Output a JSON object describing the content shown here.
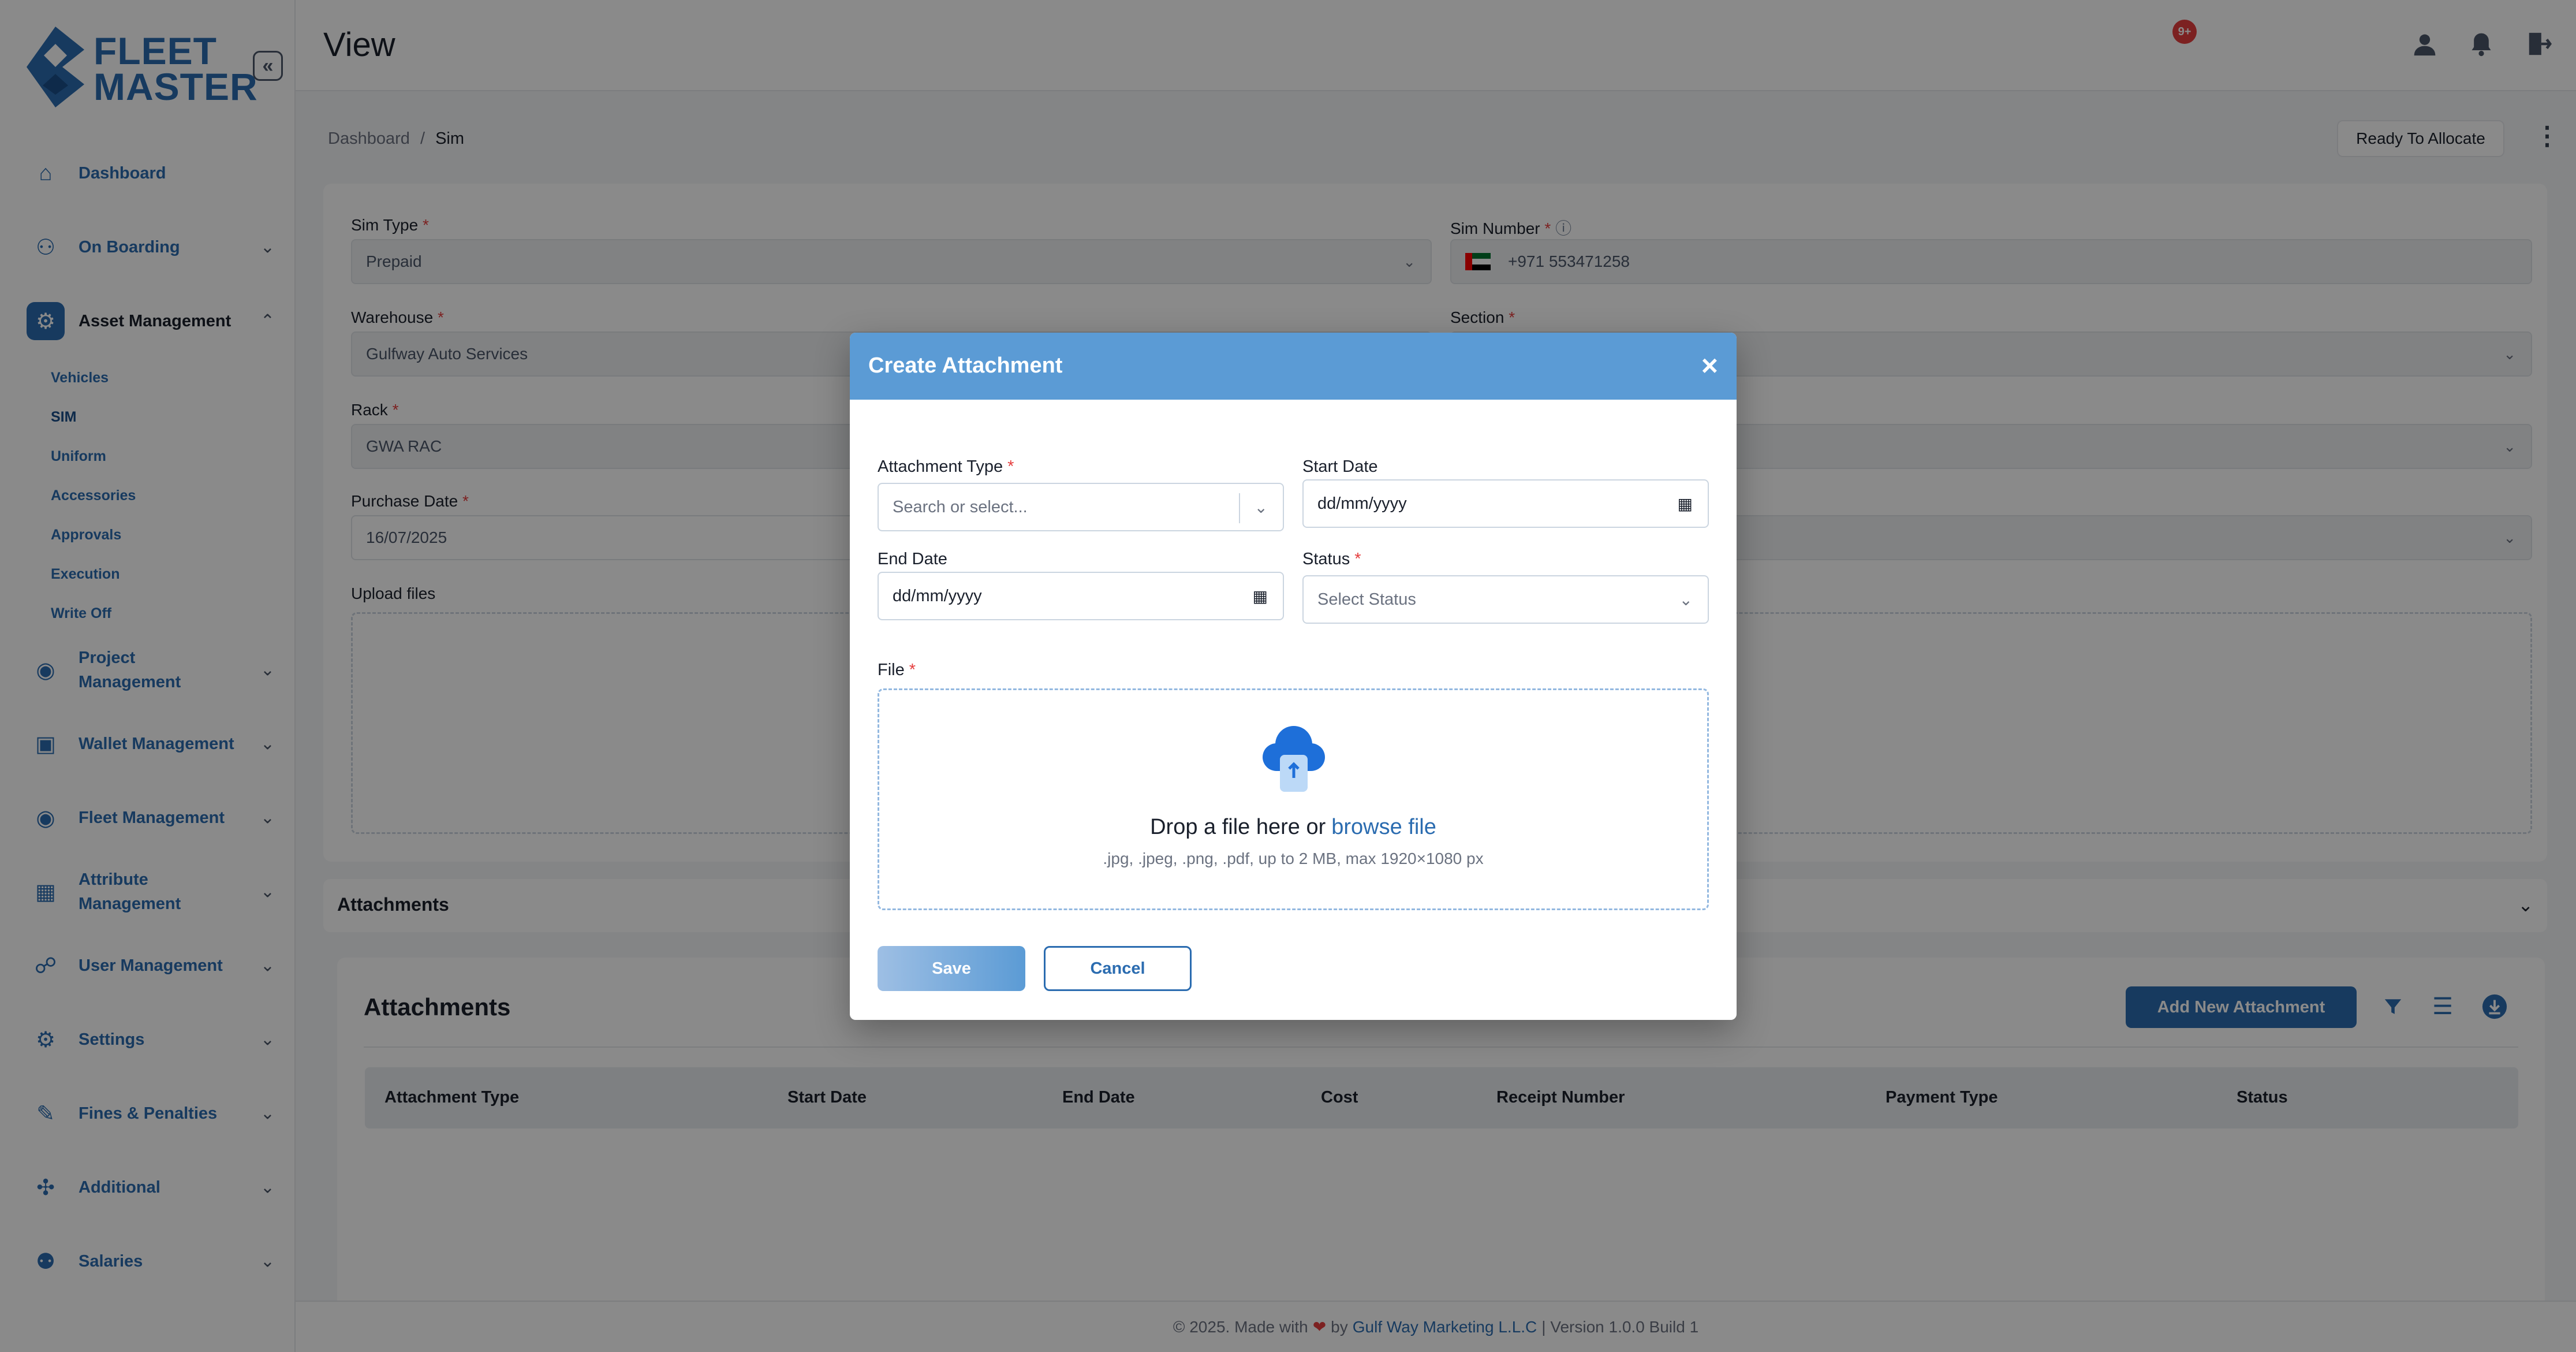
{
  "brand": {
    "line1": "FLEET",
    "line2": "MASTER"
  },
  "header": {
    "title": "View",
    "notification_count": "9+"
  },
  "sidebar": {
    "items": [
      {
        "label": "Dashboard",
        "icon": "home-icon"
      },
      {
        "label": "On Boarding",
        "icon": "onboarding-icon"
      },
      {
        "label": "Asset Management",
        "icon": "asset-icon"
      },
      {
        "label": "Project Management",
        "icon": "project-icon"
      },
      {
        "label": "Wallet Management",
        "icon": "wallet-icon"
      },
      {
        "label": "Fleet Management",
        "icon": "fleet-icon"
      },
      {
        "label": "Attribute Management",
        "icon": "attribute-icon"
      },
      {
        "label": "User Management",
        "icon": "users-icon"
      },
      {
        "label": "Settings",
        "icon": "gear-icon"
      },
      {
        "label": "Fines & Penalties",
        "icon": "fines-icon"
      },
      {
        "label": "Additional",
        "icon": "additional-icon"
      },
      {
        "label": "Salaries",
        "icon": "salaries-icon"
      }
    ],
    "asset_sub": [
      "Vehicles",
      "SIM",
      "Uniform",
      "Accessories",
      "Approvals",
      "Execution",
      "Write Off"
    ]
  },
  "breadcrumb": {
    "root": "Dashboard",
    "sep": "/",
    "current": "Sim"
  },
  "actions": {
    "ready": "Ready To Allocate"
  },
  "form": {
    "sim_type_label": "Sim Type",
    "sim_type_value": "Prepaid",
    "sim_number_label": "Sim Number",
    "sim_number_value": "+971 553471258",
    "warehouse_label": "Warehouse",
    "warehouse_value": "Gulfway Auto Services",
    "section_label": "Section",
    "rack_label": "Rack",
    "rack_value": "GWA RAC",
    "purchase_date_label": "Purchase Date",
    "purchase_date_value": "16/07/2025",
    "upload_label": "Upload files",
    "required_mark": "*"
  },
  "attachments_section": {
    "accordion_title": "Attachments",
    "card_title": "Attachments",
    "add_button": "Add New Attachment"
  },
  "table": {
    "columns": [
      "Attachment Type",
      "Start Date",
      "End Date",
      "Cost",
      "Receipt Number",
      "Payment Type",
      "Status"
    ]
  },
  "modal": {
    "title": "Create Attachment",
    "close": "×",
    "attachment_type_label": "Attachment Type",
    "attachment_type_placeholder": "Search or select...",
    "start_date_label": "Start Date",
    "start_date_placeholder": "dd/mm/yyyy",
    "end_date_label": "End Date",
    "end_date_placeholder": "dd/mm/yyyy",
    "status_label": "Status",
    "status_placeholder": "Select Status",
    "file_label": "File",
    "drop_text": "Drop a file here or",
    "browse_text": "browse file",
    "hint": ".jpg, .jpeg, .png, .pdf, up to 2 MB, max 1920×1080 px",
    "save": "Save",
    "cancel": "Cancel"
  },
  "footer": {
    "prefix": "© 2025. Made with",
    "by": "by",
    "company": "Gulf Way Marketing L.L.C",
    "version": "| Version 1.0.0 Build 1"
  },
  "colors": {
    "accent": "#2b6cb0",
    "modal_header": "#5b9bd5",
    "required": "#e53e3e"
  }
}
